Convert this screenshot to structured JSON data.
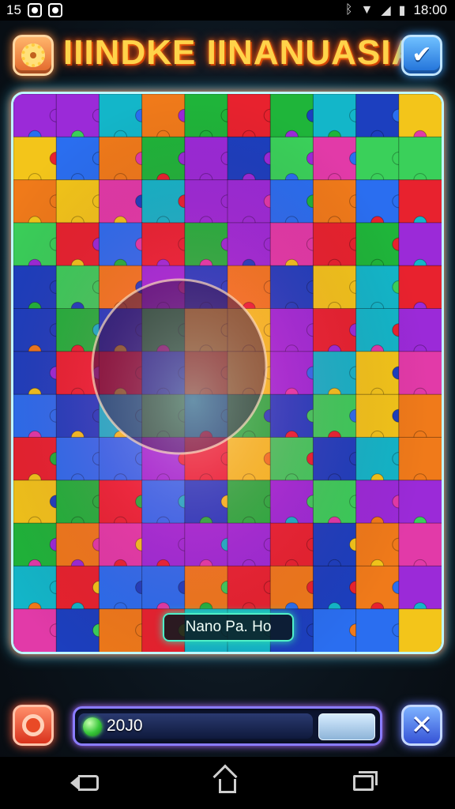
{
  "status_bar": {
    "left_number": "15",
    "time": "18:00"
  },
  "header": {
    "title": "IIINDKE IINANUASIA",
    "settings_icon": "gear-icon",
    "confirm_icon": "checkmark-icon"
  },
  "board": {
    "label": "Nano Pa. Ho"
  },
  "bottom_bar": {
    "score": "20J0",
    "progress_fraction": 0.79,
    "left_icon": "ring-icon",
    "right_icon": "close-icon"
  },
  "colors": {
    "title": "#ffd34a",
    "board_border": "#bff7ff",
    "label_border": "#4ff0c8",
    "progress_border": "#8a7cff",
    "palette": [
      "#e8222e",
      "#1fb53a",
      "#2a6ef0",
      "#f3c51a",
      "#9b2ad8",
      "#13b6c9",
      "#f07a1a",
      "#e23aa8",
      "#3ad05a",
      "#1c3fbf"
    ]
  }
}
